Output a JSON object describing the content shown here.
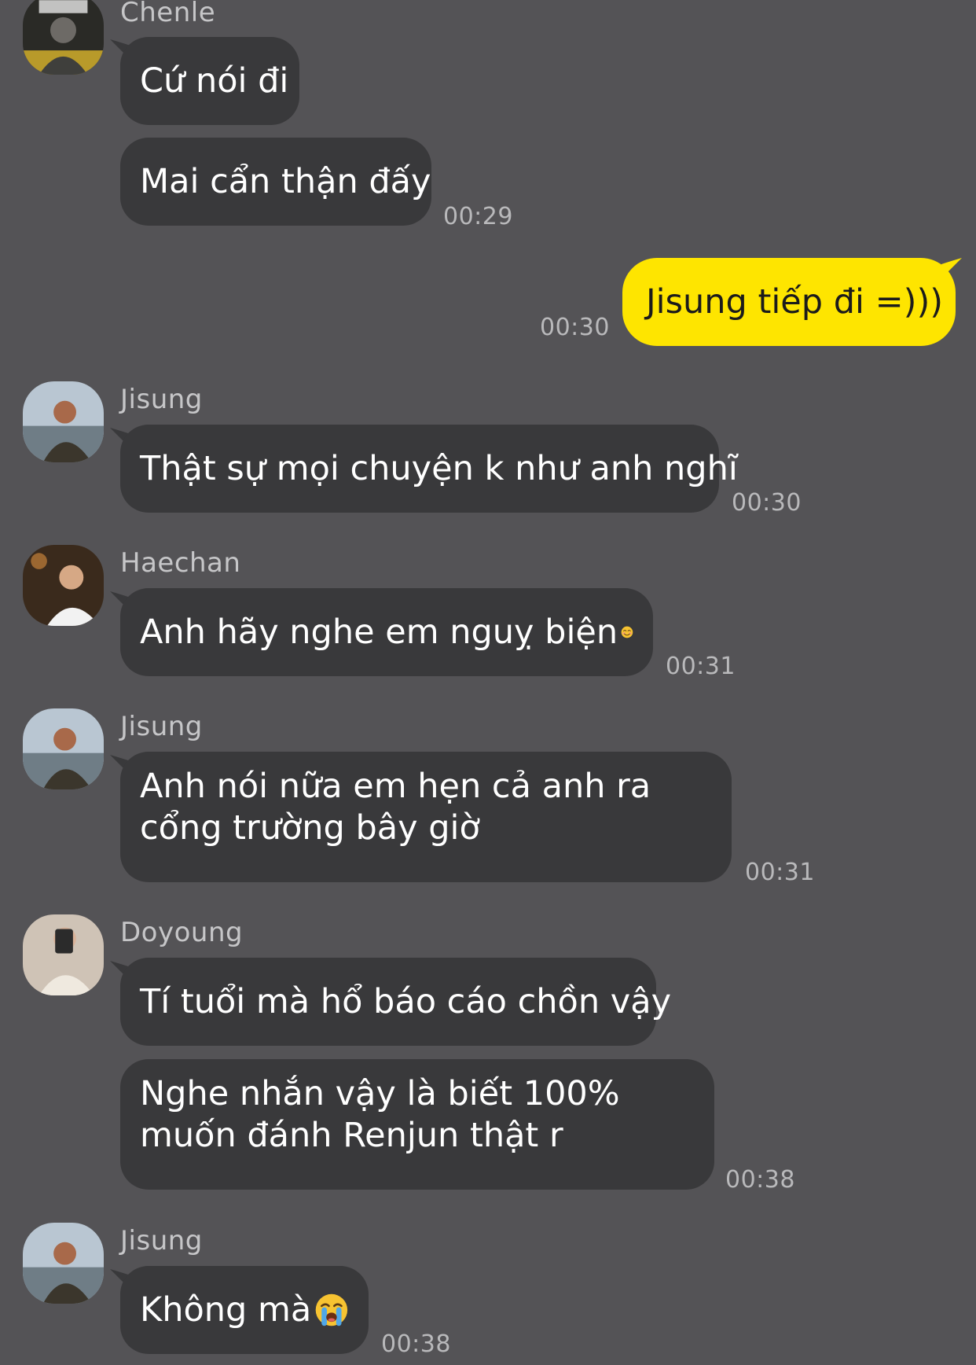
{
  "colors": {
    "background": "#545356",
    "incoming_bubble": "#39393b",
    "outgoing_bubble": "#fee500",
    "timestamp": "#b9b9bb"
  },
  "messages": [
    {
      "sender": "Chenle",
      "texts": [
        "Cứ nói đi",
        "Mai cẩn thận đấy"
      ],
      "time": "00:29"
    },
    {
      "sender": "me",
      "texts": [
        "Jisung tiếp đi =)))"
      ],
      "time": "00:30"
    },
    {
      "sender": "Jisung",
      "texts": [
        "Thật sự mọi chuyện k như anh nghĩ"
      ],
      "time": "00:30"
    },
    {
      "sender": "Haechan",
      "texts": [
        "Anh hãy nghe em nguỵ biện"
      ],
      "emoji": "smiling-face-emoji",
      "time": "00:31"
    },
    {
      "sender": "Jisung",
      "texts": [
        "Anh nói nữa em hẹn cả anh ra cổng trường bây giờ"
      ],
      "time": "00:31"
    },
    {
      "sender": "Doyoung",
      "texts": [
        "Tí tuổi mà hổ báo cáo chồn vậy",
        "Nghe nhắn vậy là biết 100% muốn đánh Renjun thật r"
      ],
      "time": "00:38"
    },
    {
      "sender": "Jisung",
      "texts": [
        "Không mà"
      ],
      "emoji": "crying-face-emoji",
      "time": "00:38"
    }
  ]
}
